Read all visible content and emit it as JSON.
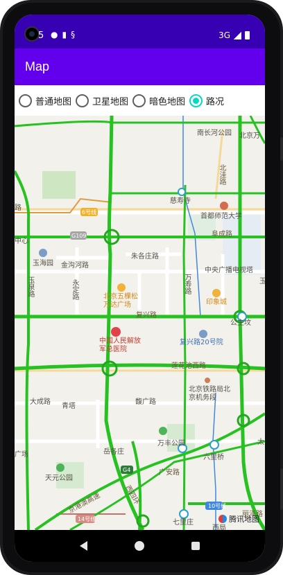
{
  "status_bar": {
    "time": "5",
    "network": "3G",
    "icons": [
      "chat-icon",
      "sim-icon",
      "sd-card-icon",
      "signal-icon",
      "battery-icon"
    ]
  },
  "app_bar": {
    "title": "Map"
  },
  "map_types": {
    "options": [
      {
        "label": "普通地图",
        "selected": false
      },
      {
        "label": "卫星地图",
        "selected": false
      },
      {
        "label": "暗色地图",
        "selected": false
      },
      {
        "label": "路况",
        "selected": true
      }
    ]
  },
  "map": {
    "labels": {
      "nanchanghe": "南长河公园",
      "beijingwan": "北京万",
      "beiwahu": "北洼路",
      "cishousi": "慈寿寺",
      "lu_left": "路",
      "metro6": "6号线",
      "shouduNormal": "首都师范大学",
      "g109": "G109",
      "fuchenglu": "阜成路",
      "zhongxin": "中心",
      "yuhaiyuan": "玉海园",
      "zhugulu": "朱各庄路",
      "jinshouhe": "金沟河路",
      "cctv": "中央广播电视塔",
      "yu": "玉",
      "yuquanlu": "玉泉路",
      "yongdinglu": "永定路",
      "wanshoulu": "万寿路",
      "wukesong": "北京五棵松万达广场",
      "yinxiangcheng": "印象城",
      "fuxinglu": "复兴路",
      "gongzhufen": "公主坟",
      "hospital": "中国人民解放军总医院",
      "fuxinglu20": "复兴路20号院",
      "lianhuachi": "莲花池西路",
      "dachenglu": "大成路",
      "qingta": "青塔",
      "fengguanlu": "馥广路",
      "railway": "北京铁路局北京机务段",
      "wanfeng": "万丰公园",
      "tai": "太",
      "chang": "广场",
      "yuegezhuang": "岳各庄",
      "liuliqiao": "六里桥",
      "tianyuan": "天元公园",
      "g4": "G4",
      "guangan": "广安路",
      "jingshi": "京港澳高速",
      "siqu": "西四环",
      "metro10": "10号线",
      "metro14": "14号线",
      "qilizhuang": "七里庄",
      "xiju": "西局",
      "lizeroad": "丽泽路",
      "watermark": "腾讯地图"
    }
  }
}
